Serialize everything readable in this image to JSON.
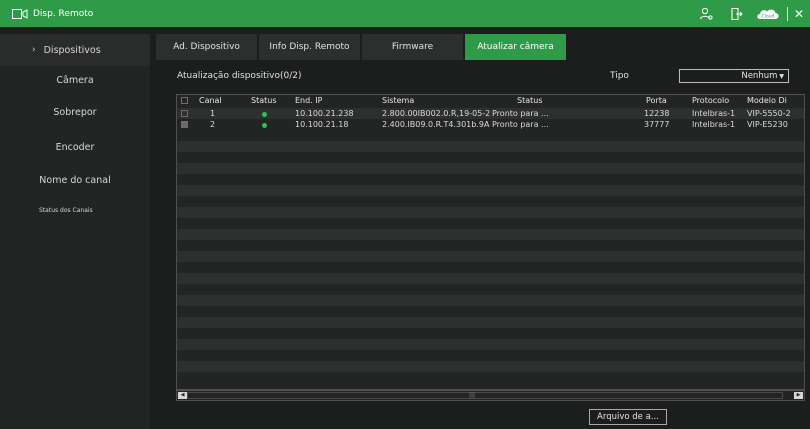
{
  "titlebar": {
    "title": "Disp. Remoto",
    "accent": "#2f9b49",
    "icons": [
      "remote-device-icon",
      "user-icon",
      "logout-icon",
      "cloud-icon"
    ],
    "cloud_label": "Cloud"
  },
  "sidebar": {
    "items": [
      {
        "label": "Dispositivos",
        "active": true
      },
      {
        "label": "Câmera"
      },
      {
        "label": "Sobrepor"
      },
      {
        "label": "Encoder"
      },
      {
        "label": "Nome do canal"
      },
      {
        "label": "Status dos Canais"
      }
    ]
  },
  "tabs": [
    {
      "label": "Ad. Dispositivo"
    },
    {
      "label": "Info Disp. Remoto"
    },
    {
      "label": "Firmware"
    },
    {
      "label": "Atualizar câmera",
      "active": true
    }
  ],
  "content": {
    "title": "Atualização dispositivo(0/2)",
    "tipo_label": "Tipo",
    "tipo_value": "Nenhum"
  },
  "table": {
    "columns": [
      "Canal",
      "Status",
      "End. IP",
      "Sistema",
      "Status",
      "Porta",
      "Protocolo",
      "Modelo Di"
    ],
    "rows": [
      {
        "canal": "1",
        "status_color": "#2fc25a",
        "ip": "10.100.21.238",
        "sistema": "2.800.00IB002.0.R,19-05-2020",
        "status": "Pronto para ...",
        "porta": "12238",
        "protocolo": "Intelbras-1",
        "modelo": "VIP-5550-2"
      },
      {
        "canal": "2",
        "status_color": "#2fc25a",
        "ip": "10.100.21.18",
        "sistema": "2.400.IB09.0.R.T4.301b.9A...",
        "status": "Pronto para ...",
        "porta": "37777",
        "protocolo": "Intelbras-1",
        "modelo": "VIP-E5230"
      }
    ]
  },
  "footer": {
    "button_label": "Arquivo de a..."
  }
}
